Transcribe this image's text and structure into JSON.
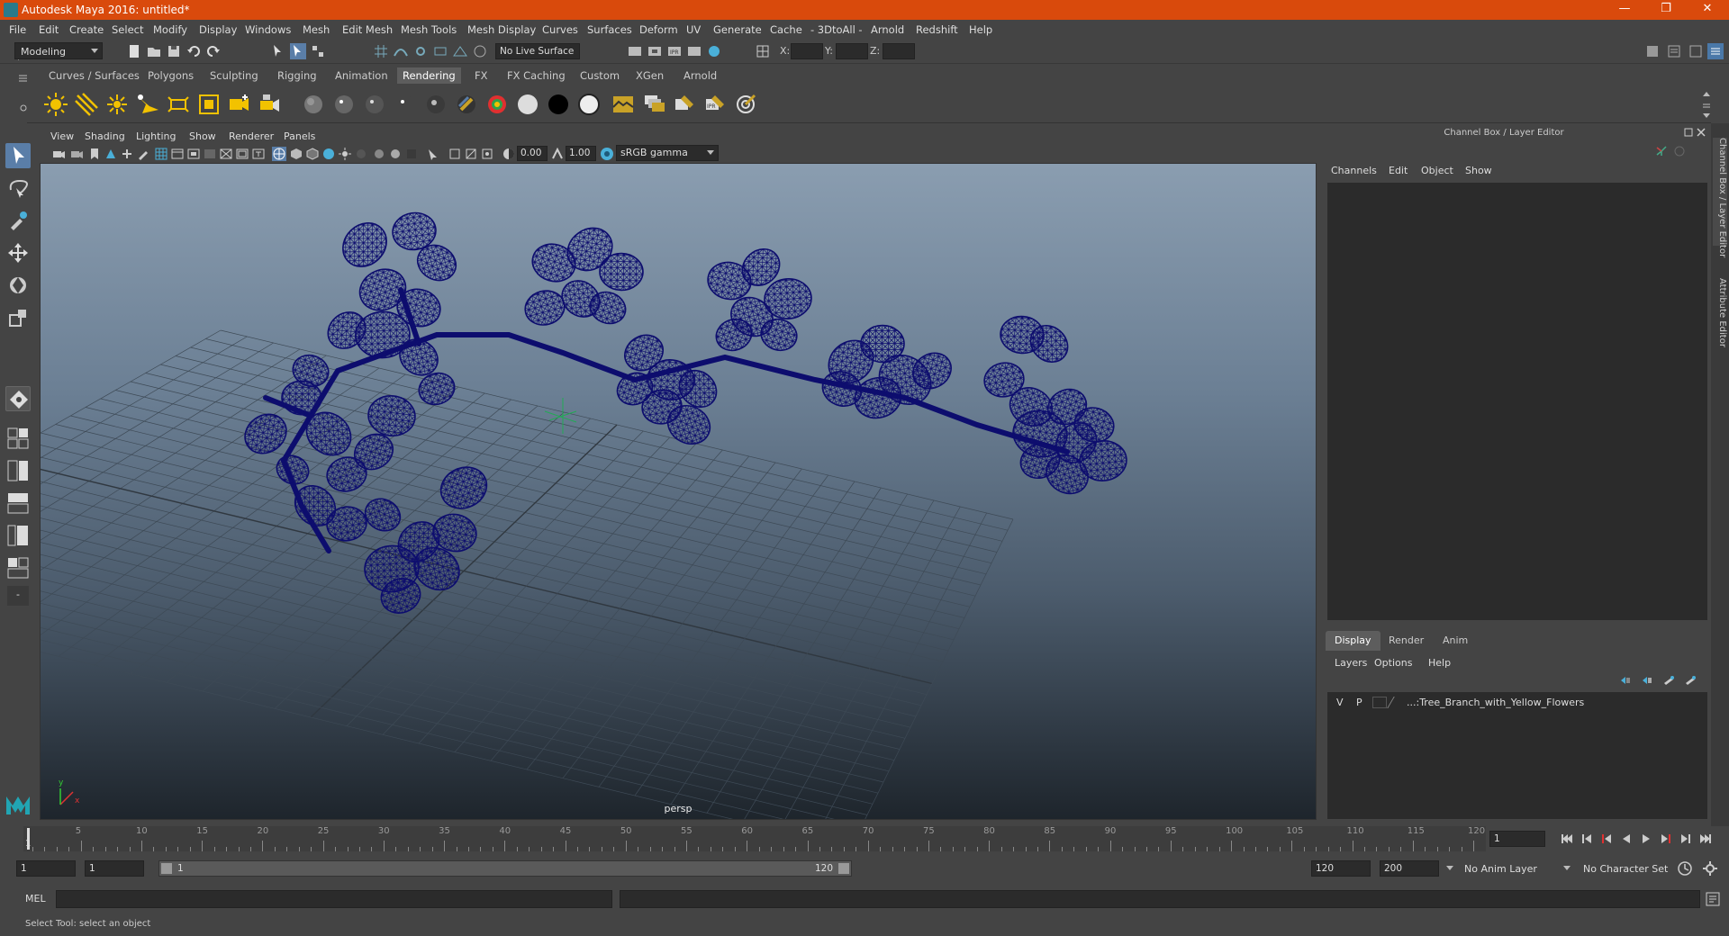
{
  "window": {
    "title": "Autodesk Maya 2016: untitled*",
    "minimize": "—",
    "restore": "❐",
    "close": "✕"
  },
  "menu": [
    "File",
    "Edit",
    "Create",
    "Select",
    "Modify",
    "Display",
    "Windows",
    "Mesh",
    "Edit Mesh",
    "Mesh Tools",
    "Mesh Display",
    "Curves",
    "Surfaces",
    "Deform",
    "UV",
    "Generate",
    "Cache",
    "- 3DtoAll -",
    "Arnold",
    "Redshift",
    "Help"
  ],
  "status": {
    "mode": "Modeling",
    "live_surface": "No Live Surface",
    "x_label": "X:",
    "y_label": "Y:",
    "z_label": "Z:"
  },
  "shelf_tabs": [
    "Curves / Surfaces",
    "Polygons",
    "Sculpting",
    "Rigging",
    "Animation",
    "Rendering",
    "FX",
    "FX Caching",
    "Custom",
    "XGen",
    "Arnold"
  ],
  "shelf_active": "Rendering",
  "viewport": {
    "menu": [
      "View",
      "Shading",
      "Lighting",
      "Show",
      "Renderer",
      "Panels"
    ],
    "exposure": "0.00",
    "gamma": "1.00",
    "color_space": "sRGB gamma",
    "camera": "persp",
    "axis_y": "y",
    "axis_x": "x",
    "wire_color": "#0d0d6e"
  },
  "channel_box": {
    "title": "Channel Box / Layer Editor",
    "menu": [
      "Channels",
      "Edit",
      "Object",
      "Show"
    ]
  },
  "layer_editor": {
    "tabs": [
      "Display",
      "Render",
      "Anim"
    ],
    "menu": [
      "Layers",
      "Options",
      "Help"
    ],
    "layer": {
      "v": "V",
      "p": "P",
      "name": "...:Tree_Branch_with_Yellow_Flowers"
    }
  },
  "side_tabs": [
    "Channel Box / Layer Editor",
    "Attribute Editor"
  ],
  "timeline": {
    "labels": [
      "5",
      "10",
      "15",
      "20",
      "25",
      "30",
      "35",
      "40",
      "45",
      "50",
      "55",
      "60",
      "65",
      "70",
      "75",
      "80",
      "85",
      "90",
      "95",
      "100",
      "105",
      "110",
      "115",
      "120"
    ],
    "start_label": "1",
    "current_frame": "1"
  },
  "range": {
    "start": "1",
    "anim_start": "1",
    "slider_start": "1",
    "slider_end": "120",
    "anim_end": "120",
    "end": "200",
    "anim_layer": "No Anim Layer",
    "char_set": "No Character Set"
  },
  "cmd": {
    "label": "MEL"
  },
  "help": {
    "text": "Select Tool: select an object"
  }
}
